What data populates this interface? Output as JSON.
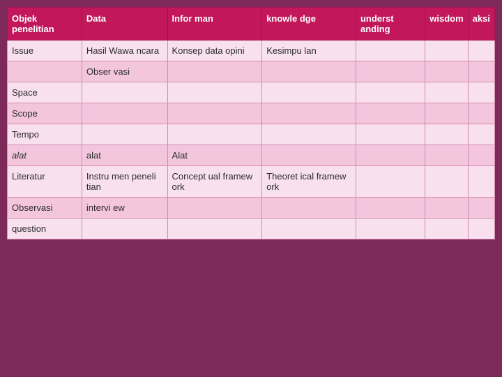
{
  "table": {
    "headers": [
      {
        "label": "Objek penelitian",
        "key": "objek"
      },
      {
        "label": "Data",
        "key": "data"
      },
      {
        "label": "Infor man",
        "key": "infor_man"
      },
      {
        "label": "knowle dge",
        "key": "knowledge"
      },
      {
        "label": "underst anding",
        "key": "understanding"
      },
      {
        "label": "wisdom",
        "key": "wisdom"
      },
      {
        "label": "aksi",
        "key": "aksi"
      }
    ],
    "rows": [
      {
        "objek": "Issue",
        "data": "Hasil Wawa ncara",
        "infor_man": "Konsep data opini",
        "knowledge": "Kesimpu lan",
        "understanding": "",
        "wisdom": "",
        "aksi": "",
        "italic": false
      },
      {
        "objek": "",
        "data": "Obser vasi",
        "infor_man": "",
        "knowledge": "",
        "understanding": "",
        "wisdom": "",
        "aksi": "",
        "italic": false
      },
      {
        "objek": "Space",
        "data": "",
        "infor_man": "",
        "knowledge": "",
        "understanding": "",
        "wisdom": "",
        "aksi": "",
        "italic": false
      },
      {
        "objek": "Scope",
        "data": "",
        "infor_man": "",
        "knowledge": "",
        "understanding": "",
        "wisdom": "",
        "aksi": "",
        "italic": false
      },
      {
        "objek": "Tempo",
        "data": "",
        "infor_man": "",
        "knowledge": "",
        "understanding": "",
        "wisdom": "",
        "aksi": "",
        "italic": false
      },
      {
        "objek": "alat",
        "data": "alat",
        "infor_man": "Alat",
        "knowledge": "",
        "understanding": "",
        "wisdom": "",
        "aksi": "",
        "italic": true
      },
      {
        "objek": "Literatur",
        "data": "Instru men peneli tian",
        "infor_man": "Concept ual framew ork",
        "knowledge": "Theoret ical framew ork",
        "understanding": "",
        "wisdom": "",
        "aksi": "",
        "italic": false
      },
      {
        "objek": "Observasi",
        "data": "intervi ew",
        "infor_man": "",
        "knowledge": "",
        "understanding": "",
        "wisdom": "",
        "aksi": "",
        "italic": false
      },
      {
        "objek": "question",
        "data": "",
        "infor_man": "",
        "knowledge": "",
        "understanding": "",
        "wisdom": "",
        "aksi": "",
        "italic": false
      }
    ]
  }
}
